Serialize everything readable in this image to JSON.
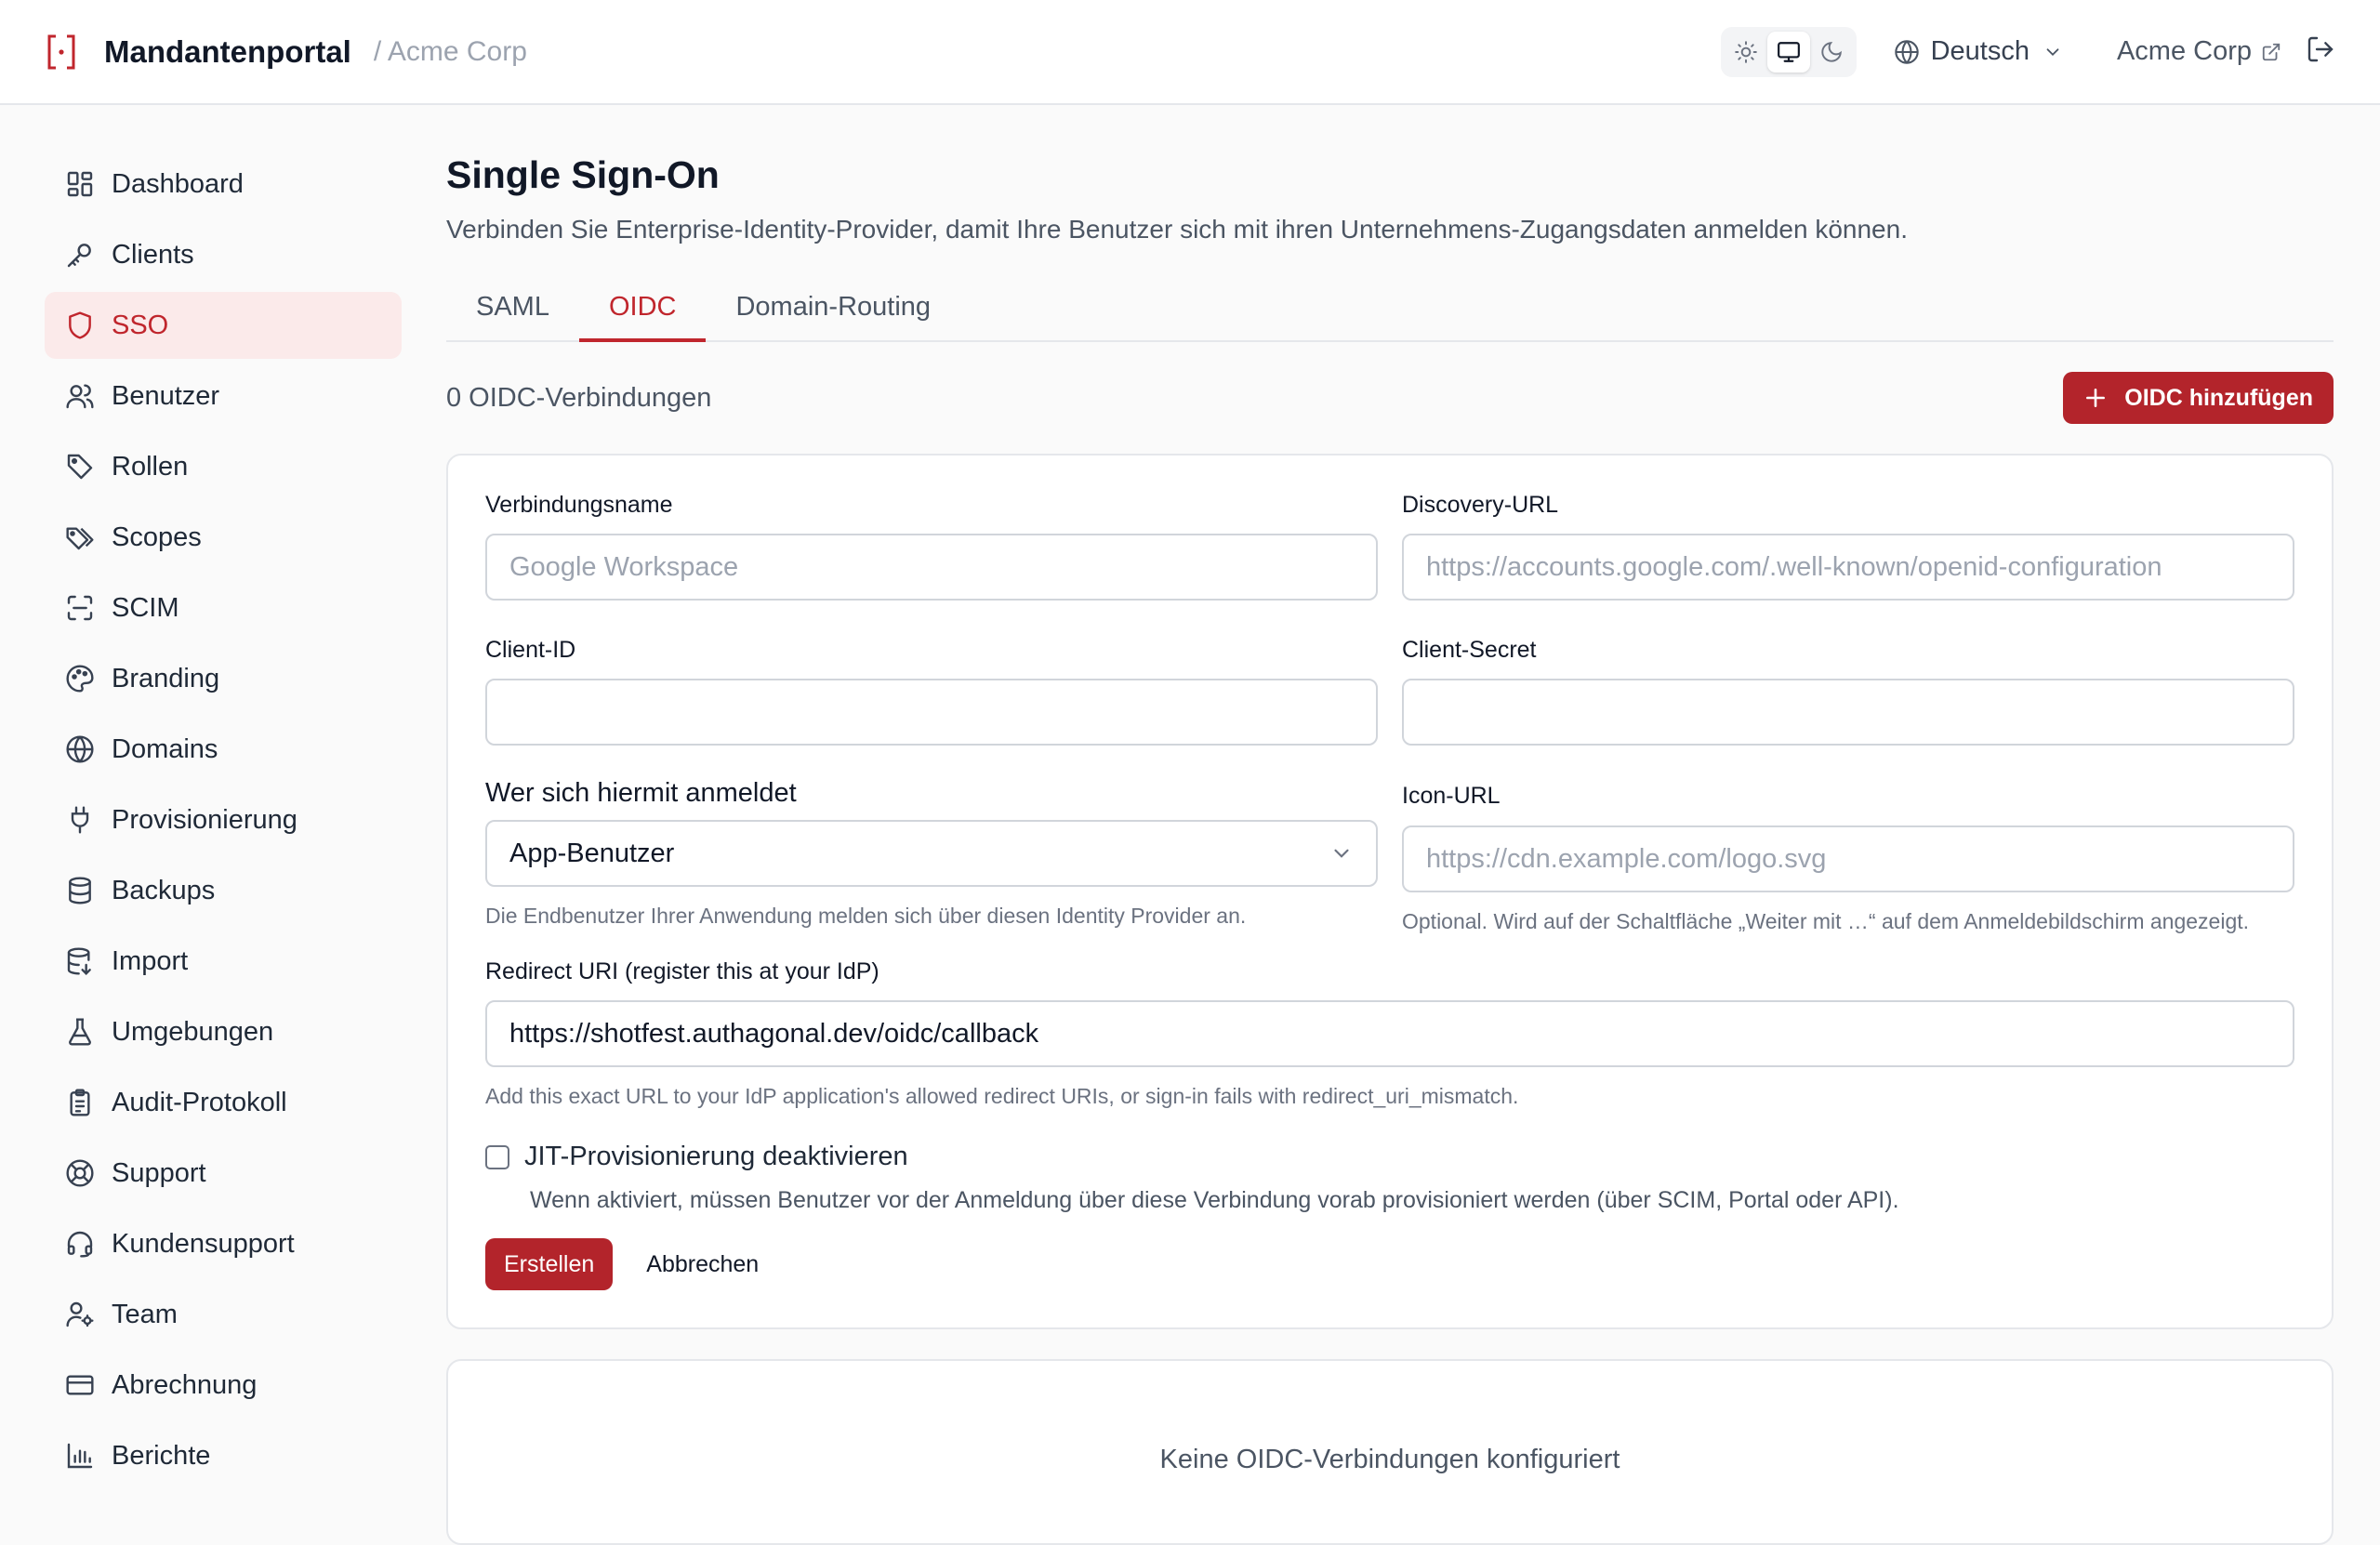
{
  "header": {
    "app_title": "Mandantenportal",
    "tenant_crumb": "/ Acme Corp",
    "theme_options": [
      "light-icon",
      "monitor-icon",
      "moon-icon"
    ],
    "theme_selected": "system",
    "language": "Deutsch",
    "tenant_link": "Acme Corp"
  },
  "sidebar": {
    "items": [
      {
        "label": "Dashboard",
        "icon": "dashboard-icon"
      },
      {
        "label": "Clients",
        "icon": "key-icon"
      },
      {
        "label": "SSO",
        "icon": "shield-icon",
        "active": true
      },
      {
        "label": "Benutzer",
        "icon": "users-icon"
      },
      {
        "label": "Rollen",
        "icon": "tag-icon"
      },
      {
        "label": "Scopes",
        "icon": "tags-icon"
      },
      {
        "label": "SCIM",
        "icon": "scan-icon"
      },
      {
        "label": "Branding",
        "icon": "palette-icon"
      },
      {
        "label": "Domains",
        "icon": "globe-icon"
      },
      {
        "label": "Provisionierung",
        "icon": "plug-icon"
      },
      {
        "label": "Backups",
        "icon": "database-icon"
      },
      {
        "label": "Import",
        "icon": "database-import-icon"
      },
      {
        "label": "Umgebungen",
        "icon": "flask-icon"
      },
      {
        "label": "Audit-Protokoll",
        "icon": "clipboard-icon"
      },
      {
        "label": "Support",
        "icon": "lifebuoy-icon"
      },
      {
        "label": "Kundensupport",
        "icon": "headset-icon"
      },
      {
        "label": "Team",
        "icon": "user-cog-icon"
      },
      {
        "label": "Abrechnung",
        "icon": "credit-card-icon"
      },
      {
        "label": "Berichte",
        "icon": "bar-chart-icon"
      }
    ]
  },
  "main": {
    "title": "Single Sign-On",
    "subtitle": "Verbinden Sie Enterprise-Identity-Provider, damit Ihre Benutzer sich mit ihren Unternehmens-Zugangsdaten anmelden können.",
    "tabs": [
      {
        "label": "SAML"
      },
      {
        "label": "OIDC",
        "active": true
      },
      {
        "label": "Domain-Routing"
      }
    ],
    "count_text": "0 OIDC-Verbindungen",
    "add_button": "OIDC hinzufügen",
    "form": {
      "connection_name_label": "Verbindungsname",
      "connection_name_placeholder": "Google Workspace",
      "discovery_url_label": "Discovery-URL",
      "discovery_url_placeholder": "https://accounts.google.com/.well-known/openid-configuration",
      "client_id_label": "Client-ID",
      "client_id_value": "",
      "client_secret_label": "Client-Secret",
      "client_secret_value": "",
      "who_label": "Wer sich hiermit anmeldet",
      "who_value": "App-Benutzer",
      "who_help": "Die Endbenutzer Ihrer Anwendung melden sich über diesen Identity Provider an.",
      "icon_url_label": "Icon-URL",
      "icon_url_placeholder": "https://cdn.example.com/logo.svg",
      "icon_url_help": "Optional. Wird auf der Schaltfläche „Weiter mit …“ auf dem Anmeldebildschirm angezeigt.",
      "redirect_label": "Redirect URI (register this at your IdP)",
      "redirect_value": "https://shotfest.authagonal.dev/oidc/callback",
      "redirect_help": "Add this exact URL to your IdP application's allowed redirect URIs, or sign-in fails with redirect_uri_mismatch.",
      "jit_label": "JIT-Provisionierung deaktivieren",
      "jit_help": "Wenn aktiviert, müssen Benutzer vor der Anmeldung über diese Verbindung vorab provisioniert werden (über SCIM, Portal oder API).",
      "jit_checked": false,
      "create_button": "Erstellen",
      "cancel_button": "Abbrechen"
    },
    "empty_text": "Keine OIDC-Verbindungen konfiguriert"
  },
  "colors": {
    "accent": "#b3242b",
    "accent_text": "#c0262d",
    "active_bg": "#fbeaea"
  }
}
